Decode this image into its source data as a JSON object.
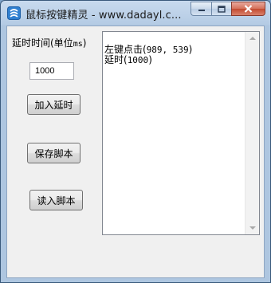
{
  "window": {
    "title": "鼠标按键精灵 - www.dadayl.c..."
  },
  "delay": {
    "label": "延时时间(单位",
    "unit": "ms",
    "label_end": ")",
    "value": "1000"
  },
  "buttons": {
    "add_delay": "加入延时",
    "save_script": "保存脚本",
    "load_script": "读入脚本"
  },
  "script_box": {
    "line1_prefix": "左键点击(",
    "line1_coords": "989, 539",
    "line1_suffix": ")",
    "line2_prefix": "延时(",
    "line2_value": "1000",
    "line2_suffix": ")"
  },
  "colors": {
    "titlebar": "#b4cbe4",
    "close_button": "#c34a30",
    "client_bg": "#f0f0f0"
  },
  "icons": [
    "app-icon",
    "minimize-icon",
    "maximize-icon",
    "close-icon",
    "scroll-up-icon",
    "scroll-down-icon"
  ]
}
